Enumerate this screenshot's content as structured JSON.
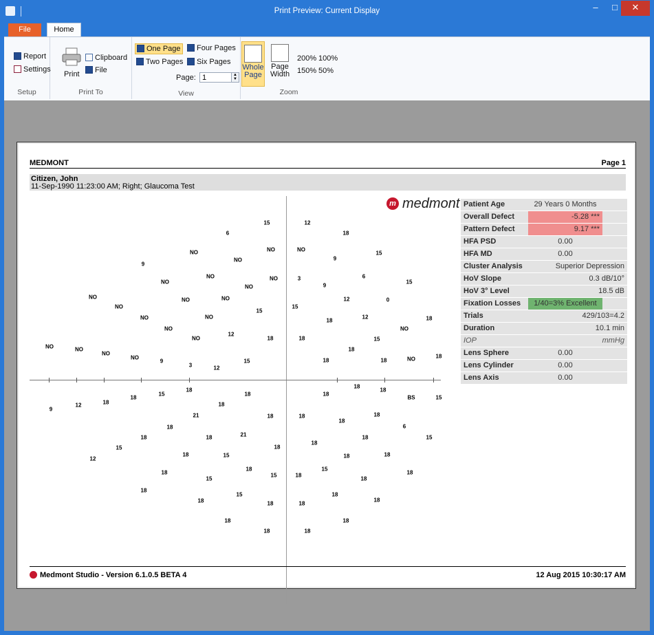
{
  "window": {
    "title": "Print Preview: Current Display",
    "min_label": "–",
    "max_label": "□",
    "close_label": "✕"
  },
  "tabs": {
    "file": "File",
    "home": "Home"
  },
  "ribbon": {
    "setup": {
      "report": "Report",
      "settings": "Settings",
      "label": "Setup"
    },
    "print_to": {
      "print": "Print",
      "clipboard": "Clipboard",
      "file": "File",
      "label": "Print To"
    },
    "view": {
      "one_page": "One Page",
      "two_pages": "Two Pages",
      "four_pages": "Four Pages",
      "six_pages": "Six Pages",
      "page_label": "Page:",
      "page_value": "1",
      "label": "View"
    },
    "zoom": {
      "whole_page_1": "Whole",
      "whole_page_2": "Page",
      "page_width_1": "Page",
      "page_width_2": "Width",
      "z200": "200%",
      "z100": "100%",
      "z150": "150%",
      "z50": "50%",
      "label": "Zoom"
    }
  },
  "report": {
    "header_left": "MEDMONT",
    "header_right": "Page 1",
    "patient_name": "Citizen, John",
    "patient_info": "11-Sep-1990 11:23:00 AM; Right; Glaucoma Test",
    "logo_letter": "m",
    "logo_text": "medmont",
    "footer_left": "Medmont Studio - Version 6.1.0.5 BETA 4",
    "footer_right": "12 Aug 2015 10:30:17 AM"
  },
  "stats": [
    {
      "label": "Patient Age",
      "value": "29 Years 0 Months",
      "style": "center"
    },
    {
      "label": "Overall Defect",
      "value": "-5.28 ***",
      "style": "red"
    },
    {
      "label": "Pattern Defect",
      "value": "9.17 ***",
      "style": "red"
    },
    {
      "label": "HFA PSD",
      "value": "0.00",
      "style": "center"
    },
    {
      "label": "HFA MD",
      "value": "0.00",
      "style": "center"
    },
    {
      "label": "Cluster Analysis",
      "value": "Superior Depression",
      "style": "plain"
    },
    {
      "label": "HoV Slope",
      "value": "0.3 dB/10°",
      "style": "plain"
    },
    {
      "label": "HoV 3° Level",
      "value": "18.5 dB",
      "style": "plain"
    },
    {
      "label": "Fixation Losses",
      "value": "1/40=3% Excellent",
      "style": "green"
    },
    {
      "label": "Trials",
      "value": "429/103=4.2",
      "style": "plain"
    },
    {
      "label": "Duration",
      "value": "10.1 min",
      "style": "plain"
    },
    {
      "label": "IOP",
      "value": "mmHg",
      "style": "italic"
    },
    {
      "label": "Lens Sphere",
      "value": "0.00",
      "style": "center"
    },
    {
      "label": "Lens Cylinder",
      "value": "0.00",
      "style": "center"
    },
    {
      "label": "Lens Axis",
      "value": "0.00",
      "style": "center"
    }
  ],
  "field_points": [
    [
      "15",
      388,
      324
    ],
    [
      "12",
      447,
      324
    ],
    [
      "6",
      331,
      339
    ],
    [
      "18",
      503,
      339
    ],
    [
      "NO",
      282,
      367
    ],
    [
      "NO",
      346,
      378
    ],
    [
      "NO",
      394,
      363
    ],
    [
      "NO",
      438,
      363
    ],
    [
      "9",
      487,
      376
    ],
    [
      "15",
      551,
      368
    ],
    [
      "9",
      208,
      384
    ],
    [
      "NO",
      306,
      402
    ],
    [
      "NO",
      240,
      410
    ],
    [
      "NO",
      362,
      417
    ],
    [
      "NO",
      398,
      405
    ],
    [
      "3",
      435,
      405
    ],
    [
      "9",
      472,
      415
    ],
    [
      "6",
      529,
      402
    ],
    [
      "15",
      595,
      410
    ],
    [
      "NO",
      135,
      432
    ],
    [
      "NO",
      270,
      436
    ],
    [
      "NO",
      328,
      434
    ],
    [
      "12",
      504,
      435
    ],
    [
      "0",
      564,
      436
    ],
    [
      "NO",
      173,
      446
    ],
    [
      "15",
      377,
      452
    ],
    [
      "15",
      429,
      446
    ],
    [
      "NO",
      210,
      462
    ],
    [
      "NO",
      304,
      461
    ],
    [
      "18",
      479,
      466
    ],
    [
      "12",
      531,
      461
    ],
    [
      "18",
      624,
      463
    ],
    [
      "NO",
      245,
      478
    ],
    [
      "NO",
      588,
      478
    ],
    [
      "12",
      336,
      486
    ],
    [
      "NO",
      285,
      492
    ],
    [
      "18",
      393,
      492
    ],
    [
      "18",
      439,
      492
    ],
    [
      "15",
      548,
      493
    ],
    [
      "NO",
      72,
      504
    ],
    [
      "NO",
      115,
      508
    ],
    [
      "18",
      511,
      508
    ],
    [
      "NO",
      154,
      514
    ],
    [
      "NO",
      196,
      520
    ],
    [
      "18",
      638,
      518
    ],
    [
      "NO",
      598,
      522
    ],
    [
      "9",
      235,
      525
    ],
    [
      "15",
      359,
      525
    ],
    [
      "18",
      474,
      524
    ],
    [
      "18",
      558,
      524
    ],
    [
      "3",
      277,
      531
    ],
    [
      "12",
      315,
      535
    ],
    [
      "18",
      275,
      567
    ],
    [
      "18",
      519,
      562
    ],
    [
      "18",
      557,
      567
    ],
    [
      "15",
      235,
      573
    ],
    [
      "18",
      194,
      578
    ],
    [
      "18",
      360,
      573
    ],
    [
      "18",
      474,
      573
    ],
    [
      "BS",
      598,
      578
    ],
    [
      "15",
      638,
      578
    ],
    [
      "18",
      154,
      585
    ],
    [
      "12",
      114,
      589
    ],
    [
      "9",
      74,
      595
    ],
    [
      "18",
      322,
      588
    ],
    [
      "21",
      285,
      604
    ],
    [
      "18",
      393,
      605
    ],
    [
      "18",
      439,
      605
    ],
    [
      "18",
      548,
      603
    ],
    [
      "18",
      497,
      612
    ],
    [
      "18",
      247,
      621
    ],
    [
      "6",
      588,
      620
    ],
    [
      "18",
      209,
      636
    ],
    [
      "21",
      354,
      632
    ],
    [
      "18",
      304,
      636
    ],
    [
      "15",
      624,
      636
    ],
    [
      "18",
      531,
      636
    ],
    [
      "15",
      173,
      651
    ],
    [
      "18",
      457,
      644
    ],
    [
      "18",
      403,
      650
    ],
    [
      "12",
      135,
      667
    ],
    [
      "18",
      270,
      661
    ],
    [
      "15",
      329,
      662
    ],
    [
      "18",
      504,
      663
    ],
    [
      "18",
      563,
      661
    ],
    [
      "18",
      362,
      682
    ],
    [
      "15",
      472,
      682
    ],
    [
      "18",
      596,
      687
    ],
    [
      "18",
      239,
      687
    ],
    [
      "15",
      304,
      696
    ],
    [
      "15",
      398,
      691
    ],
    [
      "18",
      434,
      691
    ],
    [
      "18",
      529,
      696
    ],
    [
      "18",
      209,
      713
    ],
    [
      "15",
      348,
      719
    ],
    [
      "18",
      487,
      719
    ],
    [
      "18",
      548,
      727
    ],
    [
      "18",
      292,
      728
    ],
    [
      "18",
      393,
      732
    ],
    [
      "18",
      439,
      732
    ],
    [
      "18",
      331,
      757
    ],
    [
      "18",
      503,
      757
    ],
    [
      "18",
      388,
      772
    ],
    [
      "18",
      447,
      772
    ]
  ]
}
